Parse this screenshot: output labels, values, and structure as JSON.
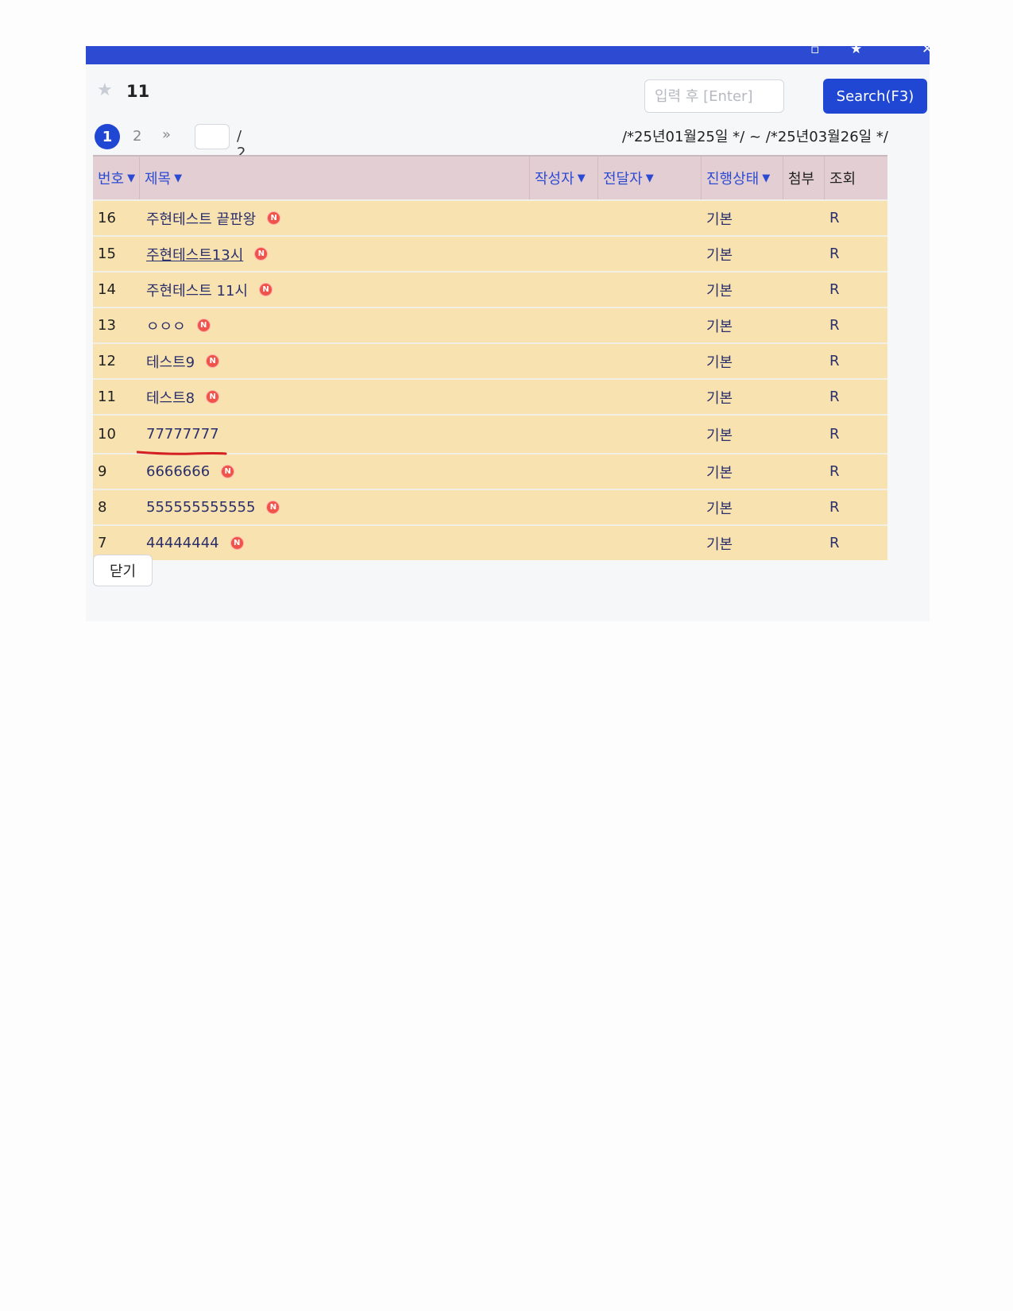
{
  "header": {
    "title": "11",
    "search_placeholder": "입력 후 [Enter]",
    "search_button": "Search(F3)"
  },
  "pager": {
    "current": "1",
    "next_page": "2",
    "next_icon": "»",
    "total": "/ 2"
  },
  "date_range": "/*25년01월25일 */ ~ /*25년03월26일 */",
  "table": {
    "columns": [
      "번호",
      "제목",
      "작성자",
      "전달자",
      "진행상태",
      "첨부",
      "조회"
    ],
    "rows": [
      {
        "no": "16",
        "title": "주현테스트 끝판왕",
        "new": true,
        "status": "기본",
        "view": "R"
      },
      {
        "no": "15",
        "title": "주현테스트13시",
        "new": true,
        "status": "기본",
        "view": "R",
        "link": true
      },
      {
        "no": "14",
        "title": "주현테스트 11시",
        "new": true,
        "status": "기본",
        "view": "R"
      },
      {
        "no": "13",
        "title": "ㅇㅇㅇ",
        "new": true,
        "status": "기본",
        "view": "R"
      },
      {
        "no": "12",
        "title": "테스트9",
        "new": true,
        "status": "기본",
        "view": "R"
      },
      {
        "no": "11",
        "title": "테스트8",
        "new": true,
        "status": "기본",
        "view": "R"
      },
      {
        "no": "10",
        "title": "77777777",
        "new": false,
        "status": "기본",
        "view": "R",
        "marked": true
      },
      {
        "no": "9",
        "title": "6666666",
        "new": true,
        "status": "기본",
        "view": "R"
      },
      {
        "no": "8",
        "title": "555555555555",
        "new": true,
        "status": "기본",
        "view": "R"
      },
      {
        "no": "7",
        "title": "44444444",
        "new": true,
        "status": "기본",
        "view": "R"
      }
    ]
  },
  "new_badge": "N",
  "close_button": "닫기",
  "colors": {
    "titlebar": "#2d4bd2",
    "accent": "#1f47d3",
    "header_row": "#e3cfd3",
    "data_row": "#f7e2b0",
    "badge": "#f0534a",
    "annotation": "#d42020"
  }
}
